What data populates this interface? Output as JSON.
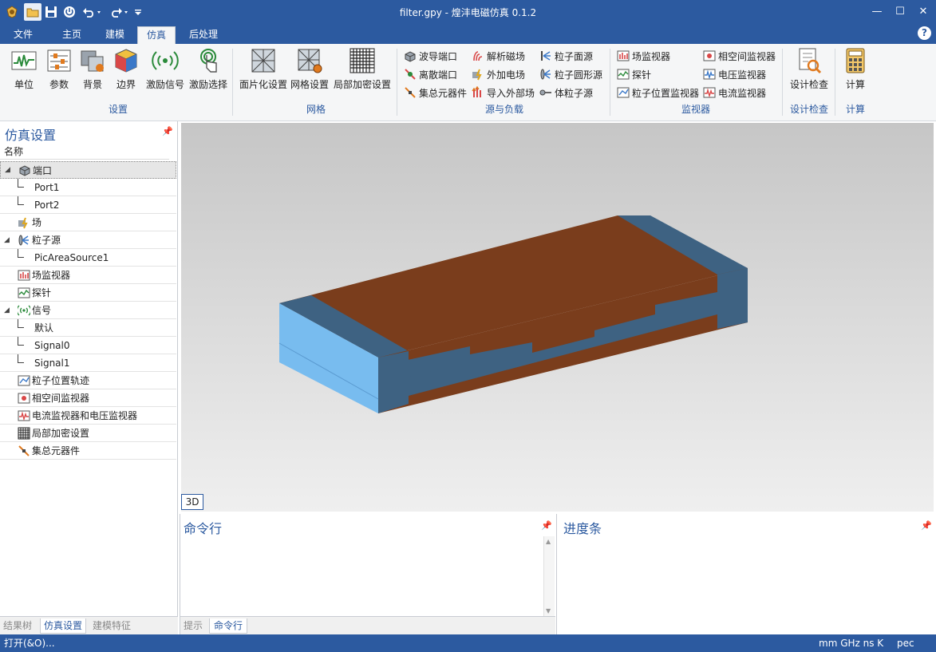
{
  "window": {
    "title": "filter.gpy -  煌沣电磁仿真 0.1.2",
    "controls": {
      "minimize": "—",
      "maximize": "☐",
      "close": "✕"
    }
  },
  "quick_access": [
    "app-logo-icon",
    "open-folder-icon",
    "save-icon",
    "power-icon",
    "undo-icon",
    "redo-icon",
    "customize-icon"
  ],
  "menu_tabs": [
    "文件",
    "主页",
    "建模",
    "仿真",
    "后处理"
  ],
  "active_tab": "仿真",
  "help": "?",
  "ribbon": {
    "groups": [
      {
        "label": "设置",
        "items": [
          "单位",
          "参数",
          "背景",
          "边界",
          "激励信号",
          "激励选择"
        ]
      },
      {
        "label": "网格",
        "items": [
          "面片化设置",
          "网格设置",
          "局部加密设置"
        ]
      },
      {
        "label": "源与负载",
        "items": [
          "波导端口",
          "离散端口",
          "集总元器件",
          "解析磁场",
          "外加电场",
          "导入外部场",
          "粒子面源",
          "粒子圆形源",
          "体粒子源"
        ]
      },
      {
        "label": "监视器",
        "items": [
          "场监视器",
          "探针",
          "粒子位置监视器",
          "相空间监视器",
          "电压监视器",
          "电流监视器"
        ]
      },
      {
        "label": "设计检查",
        "items": [
          "设计检查"
        ]
      },
      {
        "label": "计算",
        "items": [
          "计算"
        ]
      }
    ]
  },
  "left_panel": {
    "title": "仿真设置",
    "pin": "ⅰ",
    "column_header": "名称",
    "tree": [
      {
        "label": "端口",
        "level": 0,
        "expanded": true,
        "selected": true
      },
      {
        "label": "Port1",
        "level": 1
      },
      {
        "label": "Port2",
        "level": 1
      },
      {
        "label": "场",
        "level": 0
      },
      {
        "label": "粒子源",
        "level": 0,
        "expanded": true
      },
      {
        "label": "PicAreaSource1",
        "level": 1
      },
      {
        "label": "场监视器",
        "level": 0
      },
      {
        "label": "探针",
        "level": 0
      },
      {
        "label": "信号",
        "level": 0,
        "expanded": true
      },
      {
        "label": "默认",
        "level": 1
      },
      {
        "label": "Signal0",
        "level": 1
      },
      {
        "label": "Signal1",
        "level": 1
      },
      {
        "label": "粒子位置轨迹",
        "level": 0
      },
      {
        "label": "相空间监视器",
        "level": 0
      },
      {
        "label": "电流监视器和电压监视器",
        "level": 0
      },
      {
        "label": "局部加密设置",
        "level": 0
      },
      {
        "label": "集总元器件",
        "level": 0
      }
    ],
    "bottom_tabs": [
      "结果树",
      "仿真设置",
      "建模特征"
    ],
    "active_bottom_tab": "仿真设置"
  },
  "viewport": {
    "view_label": "3D"
  },
  "command_panel": {
    "title": "命令行",
    "tabs": [
      "提示",
      "命令行"
    ],
    "active_tab": "命令行"
  },
  "progress_panel": {
    "title": "进度条"
  },
  "status_bar": {
    "left": "打开(&O)...",
    "units": "mm GHz ns K",
    "material": "pec"
  },
  "colors": {
    "accent": "#2c5aa0",
    "ribbon_bg": "#f5f6f7",
    "copper": "#7a3d1c",
    "steel_blue": "#3e6282",
    "light_blue": "#78bcef"
  }
}
